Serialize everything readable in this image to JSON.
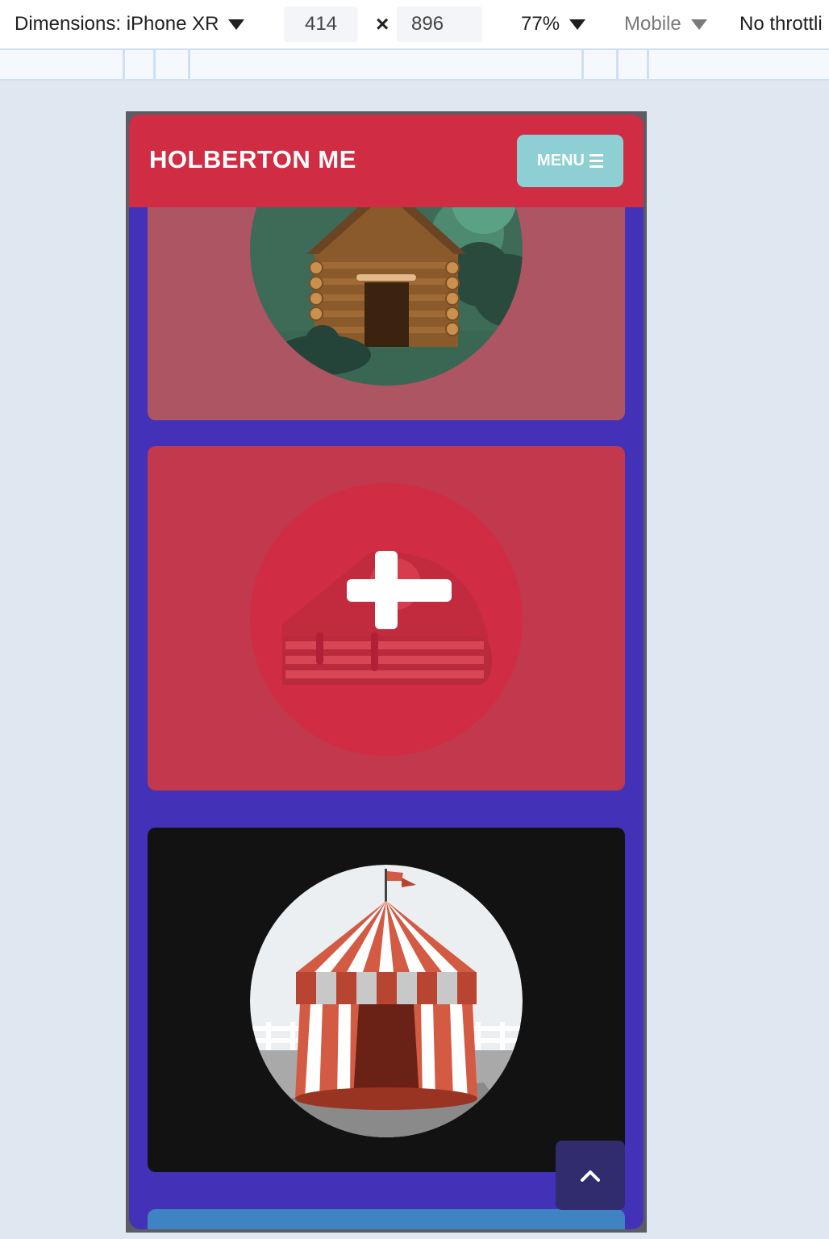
{
  "devtools": {
    "dimensions_label": "Dimensions: iPhone XR",
    "width": "414",
    "times": "×",
    "height": "896",
    "zoom": "77%",
    "device_type": "Mobile",
    "throttling": "No throttli"
  },
  "site": {
    "title": "HOLBERTON ME",
    "menu_label": "MENU",
    "brand_color": "#d02c43",
    "background_color": "#4331b7"
  },
  "cards": [
    {
      "name": "log-cabin",
      "icon": "cabin-icon",
      "color": "#ad5563"
    },
    {
      "name": "add-item",
      "icon": "plus-icon",
      "color": "#c2384c"
    },
    {
      "name": "circus-tent",
      "icon": "tent-icon",
      "color": "#121212"
    },
    {
      "name": "next-card",
      "icon": "",
      "color": "#3f83c2"
    }
  ],
  "scroll_top": {
    "icon": "chevron-up-icon"
  }
}
